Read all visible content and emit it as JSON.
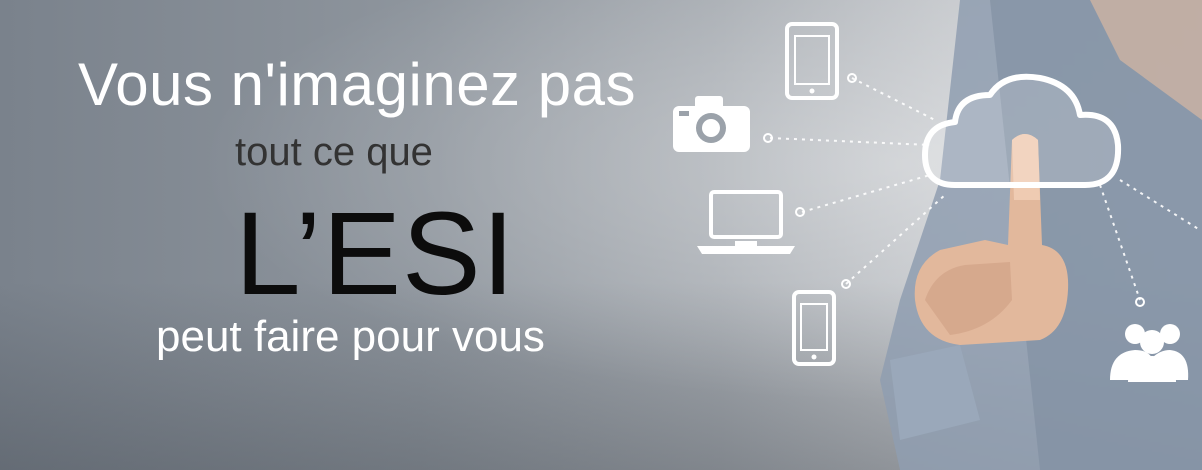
{
  "headline": {
    "line1": "Vous n'imaginez pas",
    "line2": "tout ce que",
    "line3": "L’ESI",
    "line4": "peut faire pour vous"
  },
  "colors": {
    "background": "#8e959d",
    "line1": "#ffffff",
    "line2": "#333333",
    "line3": "#0c0c0c",
    "line4": "#ffffff"
  },
  "illustration": {
    "icons": [
      "tablet-icon",
      "camera-icon",
      "laptop-icon",
      "phone-icon",
      "users-icon",
      "cloud-icon"
    ],
    "subject": "hand-pointing"
  }
}
